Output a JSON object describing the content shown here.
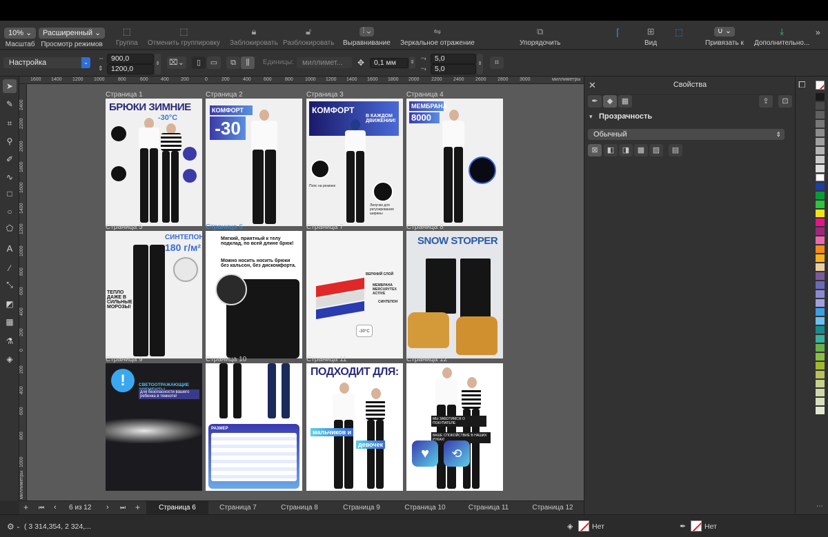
{
  "toolbar": {
    "zoom_value": "10%",
    "zoom_label": "Масштаб",
    "view_mode_value": "Расширенный",
    "view_mode_label": "Просмотр режимов",
    "group": "Группа",
    "ungroup": "Отменить группировку",
    "lock": "Заблокировать",
    "unlock": "Разблокировать",
    "align": "Выравнивание",
    "mirror": "Зеркальное отражение",
    "arrange": "Упорядочить",
    "view": "Вид",
    "snap": "Привязать к",
    "more": "Дополнительно..."
  },
  "propbar": {
    "preset": "Настройка",
    "width": "900,0",
    "height": "1200,0",
    "units_label": "Единицы:",
    "units_value": "миллимет...",
    "nudge": "0,1 мм",
    "dup_x": "5,0",
    "dup_y": "5,0"
  },
  "ruler": {
    "h_ticks": [
      "1600",
      "1400",
      "1200",
      "1000",
      "800",
      "600",
      "400",
      "200",
      "0",
      "200",
      "400",
      "600",
      "800",
      "1000",
      "1200",
      "1400",
      "1600",
      "1800",
      "2000",
      "2200",
      "2400",
      "2600",
      "2800",
      "3000"
    ],
    "h_unit": "миллиметры",
    "v_ticks": [
      "2400",
      "2200",
      "2000",
      "1800",
      "1600",
      "1400",
      "1200",
      "1000",
      "800",
      "600",
      "400",
      "200",
      "0",
      "200",
      "400",
      "600",
      "800",
      "1000"
    ],
    "v_unit": "миллиметры"
  },
  "pages": [
    {
      "label": "Страница 1",
      "headline": "БРЮКИ ЗИМНИЕ",
      "sub": "-30°C"
    },
    {
      "label": "Страница 2",
      "headline": "КОМФОРТ ДО",
      "sub": "-30"
    },
    {
      "label": "Страница 3",
      "headline": "КОМФОРТ",
      "sub": "В КАЖДОМ ДВИЖЕНИИ!",
      "note1": "Пояс на резинке",
      "note2": "Липучки для регулирования ширины"
    },
    {
      "label": "Страница 4",
      "headline": "МЕМБРАНА",
      "sub": "8000"
    },
    {
      "label": "Страница 5",
      "headline": "СИНТЕПОН",
      "sub": "180 г/м²",
      "note1": "ТЕПЛО ДАЖЕ В СИЛЬНЫЕ МОРОЗЫ!"
    },
    {
      "label": "Страница 6",
      "headline": "Мягкий, приятный к телу подклад, по всей длине брюк!",
      "sub": "Можно носить носить брюки без кальсон, без дискомфорта."
    },
    {
      "label": "Страница 7",
      "headline": "ВЕРХНИЙ СЛОЙ",
      "sub": "МЕМБРАНА MERCURYTEX ACTIVE",
      "note1": "СИНТЕПОН",
      "note2": "-30°C"
    },
    {
      "label": "Страница 8",
      "headline": "SNOW STOPPER"
    },
    {
      "label": "Страница 9",
      "headline": "СВЕТООТРАЖАЮЩИЕ ЭЛЕМЕНТЫ",
      "sub": "для безопасности вашего ребенка в темноте!"
    },
    {
      "label": "Страница 10",
      "headline": "РАЗМЕР"
    },
    {
      "label": "Страница 11",
      "headline": "ПОДХОДИТ ДЛЯ:",
      "sub": "мальчиков и",
      "note1": "девочек"
    },
    {
      "label": "Страница 12",
      "headline": "МЫ ЗАБОТИМСЯ О ПОКУПАТЕЛЕ",
      "sub": "ВАШЕ СПОКОЙСТВИЕ В НАШИХ РУКАХ!"
    }
  ],
  "page_nav": {
    "current": "6",
    "of": "из",
    "total": "12",
    "tabs": [
      "Страница 6",
      "Страница 7",
      "Страница 8",
      "Страница 9",
      "Страница 10",
      "Страница 11",
      "Страница 12"
    ]
  },
  "properties": {
    "title": "Свойства",
    "section": "Прозрачность",
    "mode": "Обычный"
  },
  "status": {
    "coords": "( 3 314,354, 2 324,...",
    "fill_label": "Нет",
    "outline_label": "Нет"
  },
  "palette_colors": [
    "#1a1a1a",
    "#4a4a4a",
    "#606060",
    "#777777",
    "#8c8c8c",
    "#a0a0a0",
    "#b5b5b5",
    "#cccccc",
    "#e0e0e0",
    "#ffffff",
    "#1c3fa0",
    "#0a9a3a",
    "#2ec43c",
    "#f2e21a",
    "#e6148c",
    "#a0287a",
    "#e86aa8",
    "#f48a1a",
    "#f5b21a",
    "#e8d0a0",
    "#7a5a9a",
    "#6a6ab8",
    "#8a8ad0",
    "#a0a0e0",
    "#3aa0e0",
    "#6ac0f0",
    "#1a8a8a",
    "#3ab0a0",
    "#6ab04a",
    "#8ac040",
    "#a0b830",
    "#b8c060",
    "#c8d090",
    "#d0d8a8",
    "#d8e0c0",
    "#e0e8d0"
  ]
}
